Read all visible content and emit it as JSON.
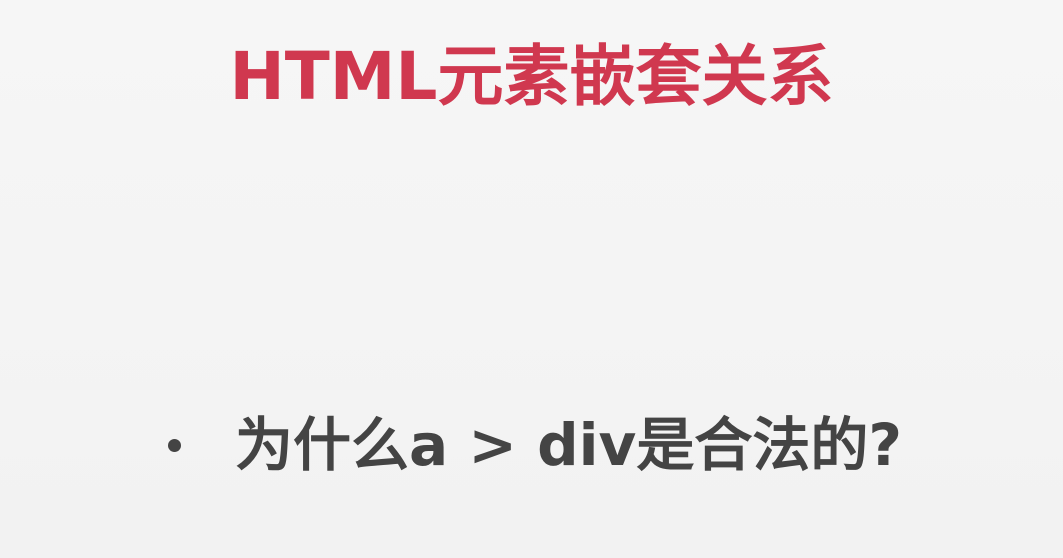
{
  "slide": {
    "title": "HTML元素嵌套关系",
    "bullets": [
      {
        "text": "为什么a > div是合法的?"
      }
    ]
  },
  "colors": {
    "title": "#d0384f",
    "body_text": "#444444",
    "background": "#f3f3f3"
  }
}
